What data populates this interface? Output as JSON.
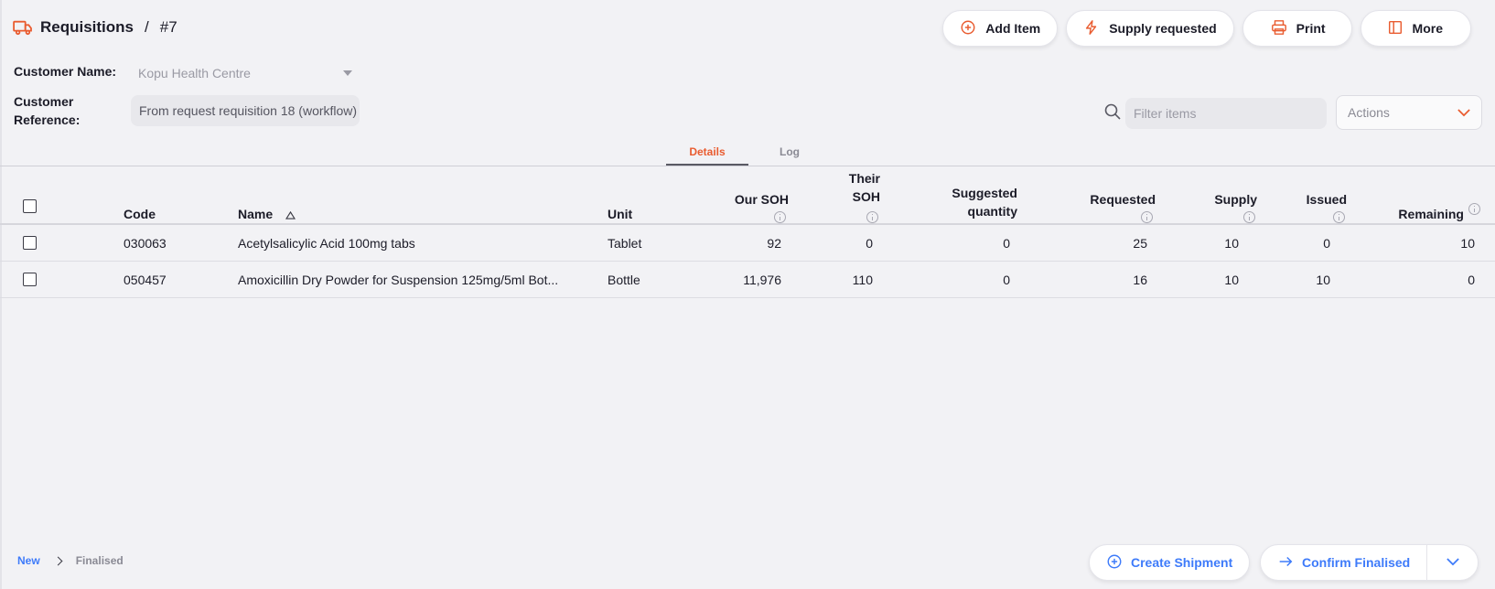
{
  "header": {
    "title": "Requisitions",
    "separator": "/",
    "number": "#7",
    "title_icon": "truck-icon"
  },
  "toolbar": {
    "add_item": {
      "label": "Add Item",
      "icon": "plus-circle-icon"
    },
    "supply_requested": {
      "label": "Supply requested",
      "icon": "lightning-icon"
    },
    "print": {
      "label": "Print",
      "icon": "printer-icon"
    },
    "more": {
      "label": "More",
      "icon": "sidebar-panel-icon"
    }
  },
  "form": {
    "customer_name_label": "Customer Name:",
    "customer_name_value": "Kopu Health Centre",
    "customer_reference_label_1": "Customer",
    "customer_reference_label_2": "Reference:",
    "customer_reference_value": "From request requisition 18 (workflow)"
  },
  "filter": {
    "placeholder": "Filter items",
    "actions_label": "Actions"
  },
  "tabs": [
    {
      "label": "Details",
      "active": true
    },
    {
      "label": "Log",
      "active": false
    }
  ],
  "table": {
    "columns": {
      "code": "Code",
      "name": "Name",
      "unit": "Unit",
      "our_soh_1": "Our SOH",
      "their_soh_1": "Their",
      "their_soh_2": "SOH",
      "suggested_1": "Suggested",
      "suggested_2": "quantity",
      "requested": "Requested",
      "supply": "Supply",
      "issued": "Issued",
      "remaining": "Remaining"
    },
    "sorted_by": "Name",
    "rows": [
      {
        "code": "030063",
        "name": "Acetylsalicylic Acid 100mg tabs",
        "unit": "Tablet",
        "our_soh": "92",
        "their_soh": "0",
        "suggested": "0",
        "requested": "25",
        "supply": "10",
        "issued": "0",
        "remaining": "10"
      },
      {
        "code": "050457",
        "name": "Amoxicillin Dry Powder for Suspension 125mg/5ml Bot...",
        "unit": "Bottle",
        "our_soh": "11,976",
        "their_soh": "110",
        "suggested": "0",
        "requested": "16",
        "supply": "10",
        "issued": "10",
        "remaining": "0"
      }
    ]
  },
  "footer": {
    "status_new": "New",
    "status_finalised": "Finalised",
    "create_shipment": "Create Shipment",
    "confirm_finalised": "Confirm Finalised"
  },
  "colors": {
    "accent": "#e95c30",
    "primary_blue": "#3e7bfa",
    "background": "#f2f2f5"
  }
}
